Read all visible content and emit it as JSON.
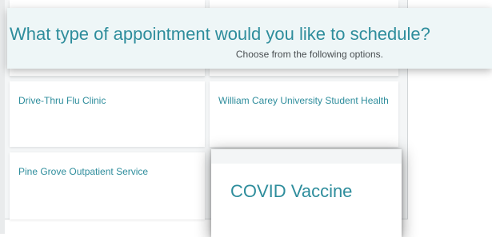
{
  "header": {
    "title": "What type of appointment would you like to schedule?",
    "subtitle": "Choose from the following options."
  },
  "options": [
    {
      "label": ""
    },
    {
      "label": ""
    },
    {
      "label": "Drive-Thru Flu Clinic"
    },
    {
      "label": "William Carey University Student Health"
    },
    {
      "label": "Pine Grove Outpatient Service"
    },
    {
      "label": "COVID Vaccine"
    }
  ],
  "colors": {
    "accent": "#2e8d9c",
    "banner_bg": "#eef6f7",
    "panel_bg": "#f4f6f7",
    "subtitle": "#4a4f52"
  }
}
